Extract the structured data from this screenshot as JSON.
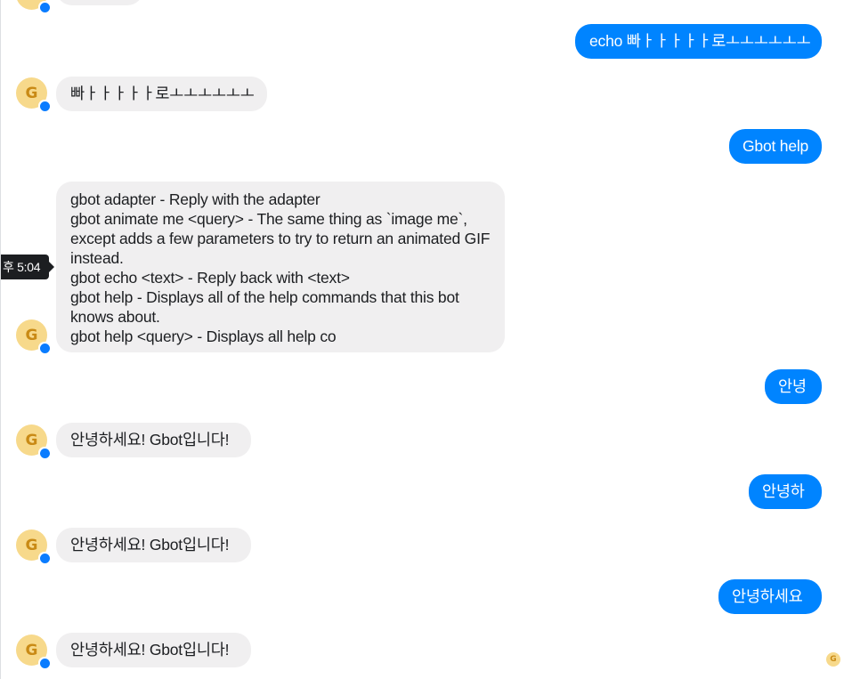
{
  "bot": {
    "avatar_letter": "G",
    "badge_icon": "messenger-icon"
  },
  "tooltip": {
    "time": "후 5:04"
  },
  "messages": [
    {
      "dir": "out",
      "text": "echo 빠ㅏㅏㅏㅏㅏ로ㅗㅗㅗㅗㅗㅗ"
    },
    {
      "dir": "in",
      "text": "빠ㅏㅏㅏㅏㅏ로ㅗㅗㅗㅗㅗㅗ"
    },
    {
      "dir": "out",
      "text": "Gbot help"
    },
    {
      "dir": "in",
      "text": "gbot adapter - Reply with the adapter\ngbot animate me <query> - The same thing as `image me`, except adds a few parameters to try to return an animated GIF instead.\ngbot echo <text> - Reply back with <text>\ngbot help - Displays all of the help commands that this bot knows about.\ngbot help <query> - Displays all help co"
    },
    {
      "dir": "out",
      "text": "안녕"
    },
    {
      "dir": "in",
      "text": "안녕하세요! Gbot입니다!"
    },
    {
      "dir": "out",
      "text": "안녕하"
    },
    {
      "dir": "in",
      "text": "안녕하세요! Gbot입니다!"
    },
    {
      "dir": "out",
      "text": "안녕하세요"
    },
    {
      "dir": "in",
      "text": "안녕하세요! Gbot입니다!"
    }
  ],
  "colors": {
    "outgoing_bubble": "#0084ff",
    "incoming_bubble": "#f0eff0",
    "avatar_bg": "#f7d98b",
    "avatar_fg": "#c98a15"
  }
}
